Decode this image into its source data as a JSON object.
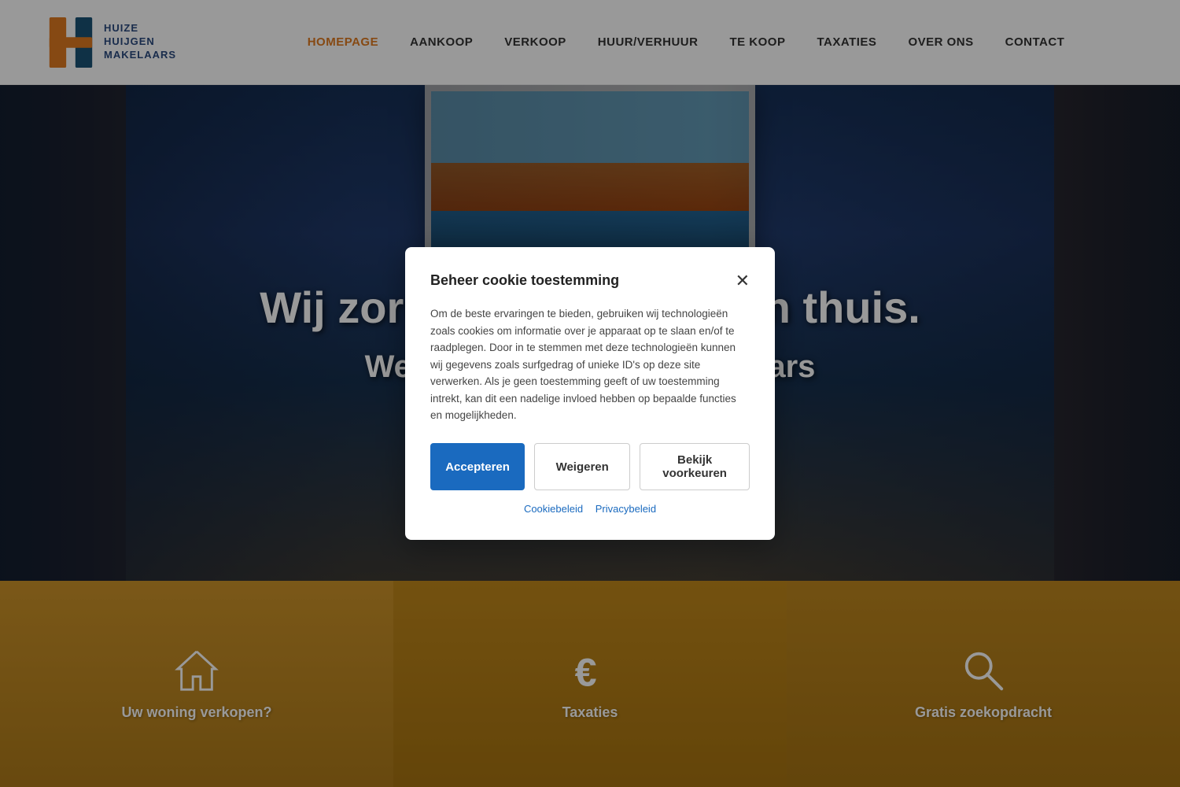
{
  "header": {
    "logo": {
      "line1": "HUIZE",
      "line2": "HUIJGEN",
      "line3": "MAKELAARS"
    },
    "nav": {
      "items": [
        {
          "label": "HOMEPAGE",
          "active": true
        },
        {
          "label": "AANKOOP",
          "active": false
        },
        {
          "label": "VERKOOP",
          "active": false
        },
        {
          "label": "HUUR/VERHUUR",
          "active": false
        },
        {
          "label": "TE KOOP",
          "active": false
        },
        {
          "label": "TAXATIES",
          "active": false
        },
        {
          "label": "OVER ONS",
          "active": false
        },
        {
          "label": "CONTACT",
          "active": false
        }
      ]
    }
  },
  "hero": {
    "title": "Wij zorgen voor... het een thuis.",
    "title_partial1": "Wij zorgen voo",
    "title_partial2": "het een thuis.",
    "subtitle": "Welko",
    "subtitle2": "elaars"
  },
  "cookie": {
    "title": "Beheer cookie toestemming",
    "body": "Om de beste ervaringen te bieden, gebruiken wij technologieën zoals cookies om informatie over je apparaat op te slaan en/of te raadplegen. Door in te stemmen met deze technologieën kunnen wij gegevens zoals surfgedrag of unieke ID's op deze site verwerken. Als je geen toestemming geeft of uw toestemming intrekt, kan dit een nadelige invloed hebben op bepaalde functies en mogelijkheden.",
    "btn_accept": "Accepteren",
    "btn_reject": "Weigeren",
    "btn_prefs": "Bekijk voorkeuren",
    "link_cookie": "Cookiebeleid",
    "link_privacy": "Privacybeleid"
  },
  "cards": [
    {
      "label": "Uw woning verkopen?",
      "icon": "house"
    },
    {
      "label": "Taxaties",
      "icon": "euro"
    },
    {
      "label": "Gratis zoekopdracht",
      "icon": "search"
    }
  ]
}
